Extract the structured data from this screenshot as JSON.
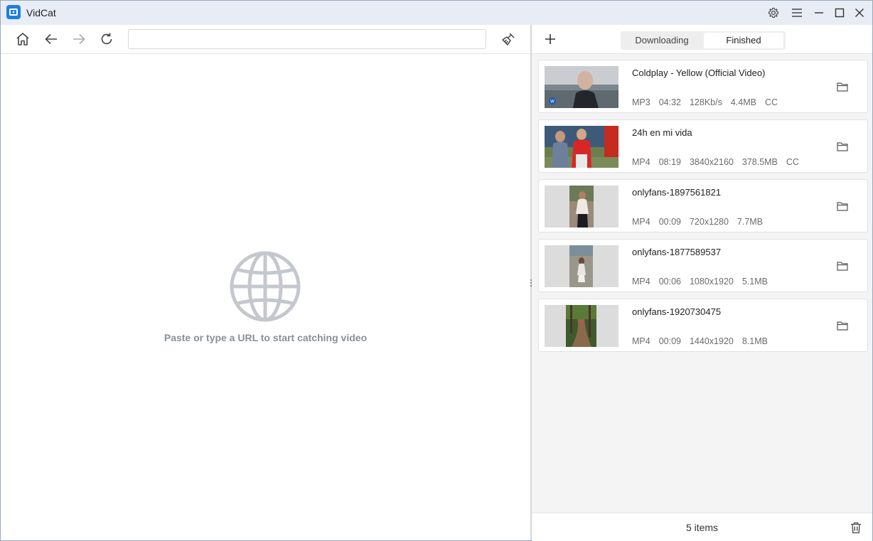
{
  "app": {
    "title": "VidCat"
  },
  "browser": {
    "url_value": "",
    "hint": "Paste or type a URL to start catching video"
  },
  "tabs": {
    "downloading": "Downloading",
    "finished": "Finished"
  },
  "items": [
    {
      "title": "Coldplay - Yellow (Official Video)",
      "format": "MP3",
      "duration": "04:32",
      "quality": "128Kb/s",
      "size": "4.4MB",
      "cc": "CC"
    },
    {
      "title": "24h en mi vida",
      "format": "MP4",
      "duration": "08:19",
      "quality": "3840x2160",
      "size": "378.5MB",
      "cc": "CC"
    },
    {
      "title": "onlyfans-1897561821",
      "format": "MP4",
      "duration": "00:09",
      "quality": "720x1280",
      "size": "7.7MB"
    },
    {
      "title": "onlyfans-1877589537",
      "format": "MP4",
      "duration": "00:06",
      "quality": "1080x1920",
      "size": "5.1MB"
    },
    {
      "title": "onlyfans-1920730475",
      "format": "MP4",
      "duration": "00:09",
      "quality": "1440x1920",
      "size": "8.1MB"
    }
  ],
  "footer": {
    "count": "5 items"
  },
  "colors": {
    "accent": "#1e7fe0",
    "titlebar": "#e8ecf4",
    "panel_bg": "#f4f4f4"
  }
}
